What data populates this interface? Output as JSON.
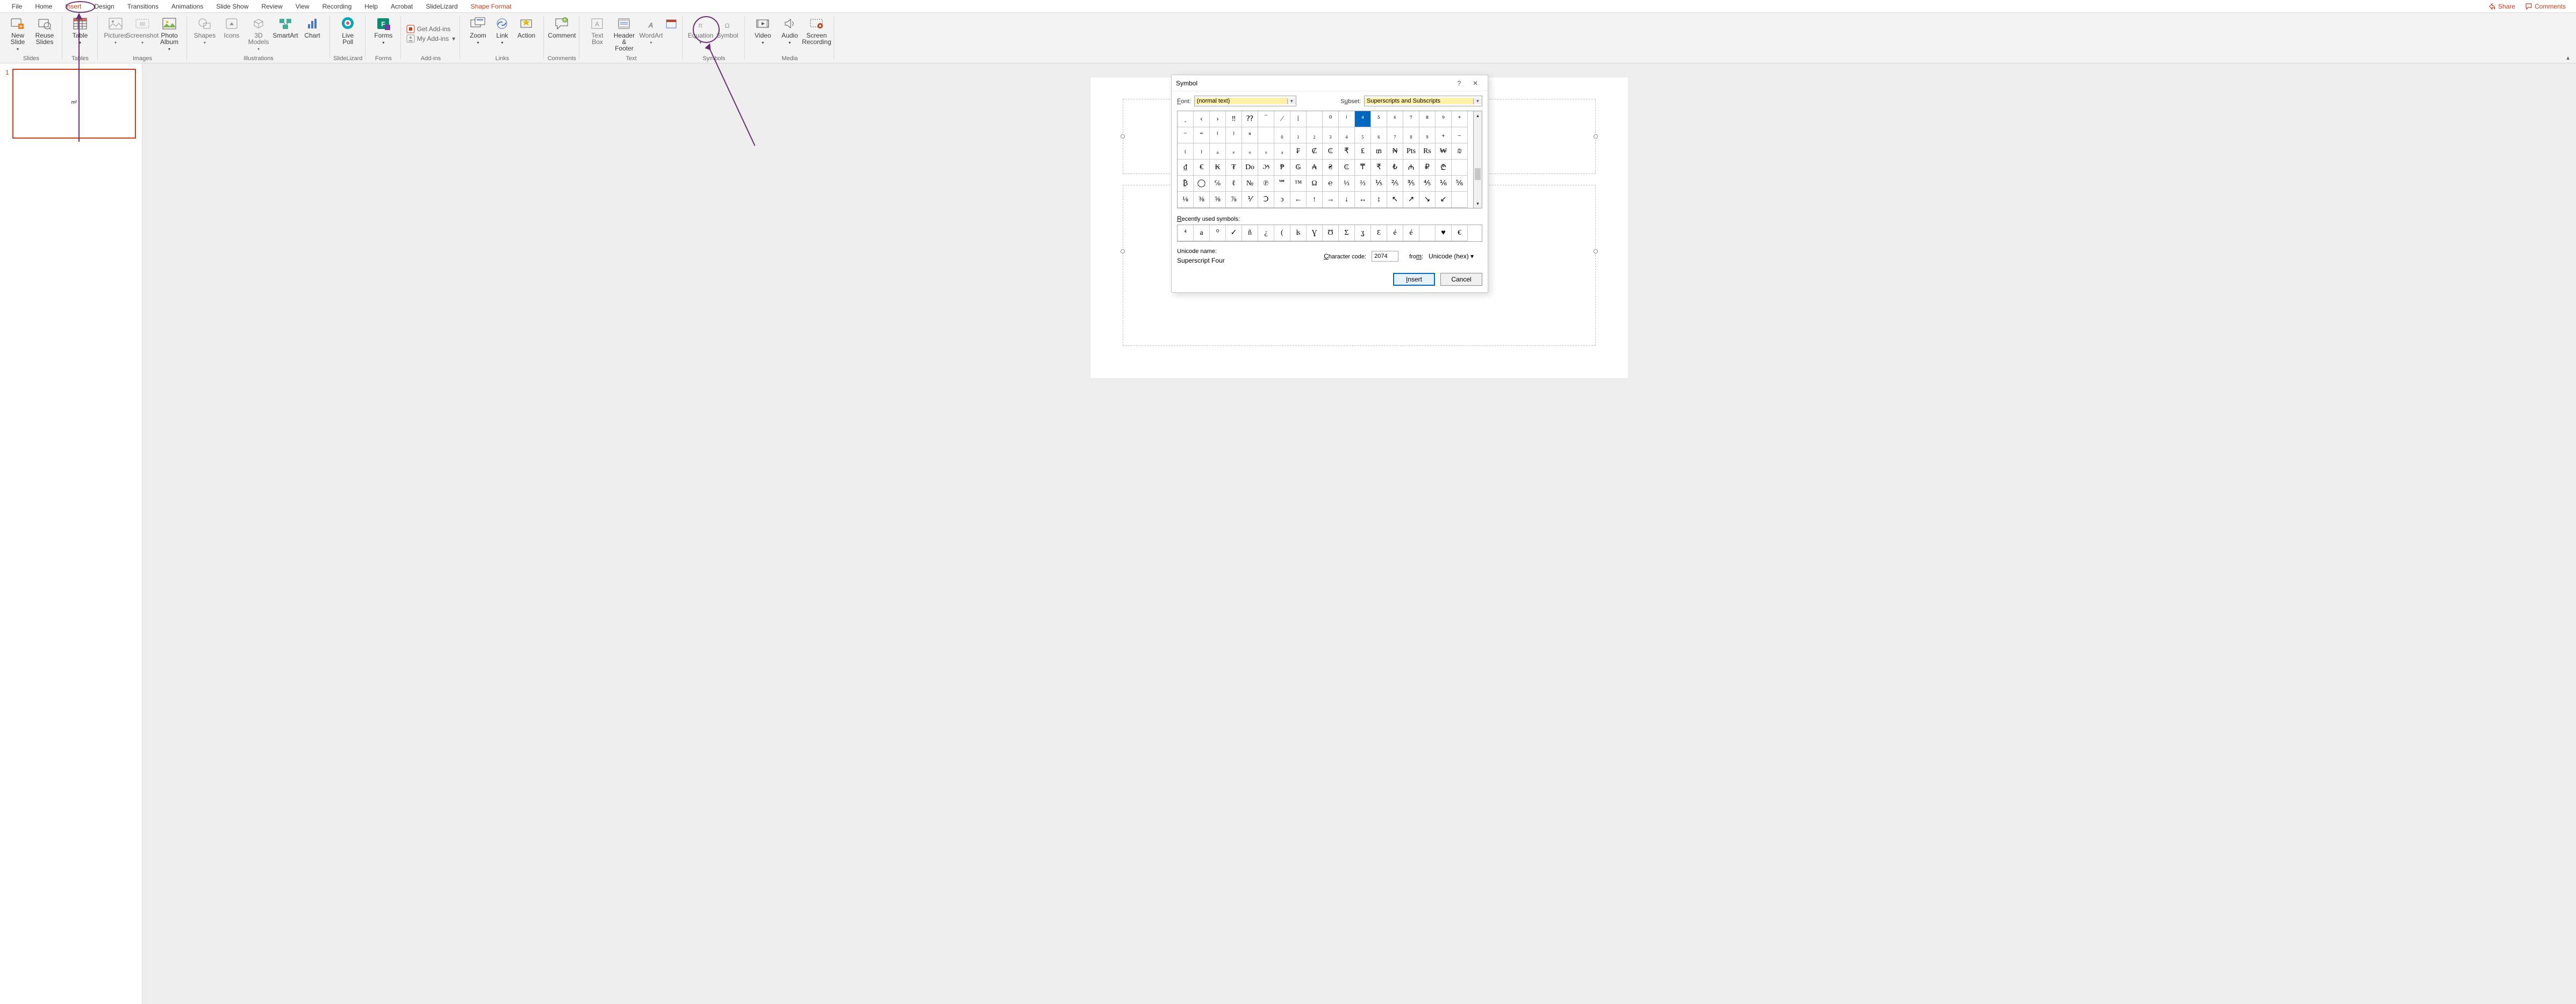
{
  "menubar": {
    "tabs": [
      "File",
      "Home",
      "Insert",
      "Design",
      "Transitions",
      "Animations",
      "Slide Show",
      "Review",
      "View",
      "Recording",
      "Help",
      "Acrobat",
      "SlideLizard",
      "Shape Format"
    ],
    "share": "Share",
    "comments": "Comments"
  },
  "ribbon": {
    "groups": {
      "slides": {
        "label": "Slides",
        "new_slide": "New\nSlide",
        "reuse": "Reuse\nSlides"
      },
      "tables": {
        "label": "Tables",
        "table": "Table"
      },
      "images": {
        "label": "Images",
        "pictures": "Pictures",
        "screenshot": "Screenshot",
        "photo_album": "Photo\nAlbum"
      },
      "illustrations": {
        "label": "Illustrations",
        "shapes": "Shapes",
        "icons": "Icons",
        "models": "3D\nModels",
        "smartart": "SmartArt",
        "chart": "Chart"
      },
      "slidelizard": {
        "label": "SlideLizard",
        "live_poll": "Live\nPoll"
      },
      "forms": {
        "label": "Forms",
        "forms": "Forms"
      },
      "addins": {
        "label": "Add-ins",
        "get": "Get Add-ins",
        "my": "My Add-ins"
      },
      "links": {
        "label": "Links",
        "zoom": "Zoom",
        "link": "Link",
        "action": "Action"
      },
      "comments": {
        "label": "Comments",
        "comment": "Comment"
      },
      "text": {
        "label": "Text",
        "textbox": "Text\nBox",
        "header": "Header\n& Footer",
        "wordart": "WordArt",
        "date": ""
      },
      "symbols": {
        "label": "Symbols",
        "equation": "Equation",
        "symbol": "Symbol"
      },
      "media": {
        "label": "Media",
        "video": "Video",
        "audio": "Audio",
        "screen": "Screen\nRecording"
      }
    }
  },
  "thumb": {
    "num": "1",
    "content": "m²"
  },
  "dialog": {
    "title": "Symbol",
    "font_label": "Font:",
    "font_value": "(normal text)",
    "subset_label": "Subset:",
    "subset_value": "Superscripts and Subscripts",
    "grid": [
      [
        "˰",
        "‹",
        "›",
        "‼",
        "⁇",
        "‾",
        "⁄",
        "⁞",
        "",
        "⁰",
        "ⁱ",
        "⁴",
        "⁵",
        "⁶",
        "⁷",
        "⁸",
        "⁹",
        "⁺"
      ],
      [
        "⁻",
        "⁼",
        "⁽",
        "⁾",
        "ⁿ",
        "",
        "₀",
        "₁",
        "₂",
        "₃",
        "₄",
        "₅",
        "₆",
        "₇",
        "₈",
        "₉",
        "₊",
        "₋"
      ],
      [
        "₍",
        "₎",
        "ₐ",
        "ₑ",
        "ₒ",
        "ₓ",
        "ₔ",
        "₣",
        "₡",
        "₵",
        "₹",
        "₤",
        "₥",
        "₦",
        "Pts",
        "Rs",
        "₩",
        "₪"
      ],
      [
        "₫",
        "€",
        "₭",
        "₮",
        "Do",
        "ઝ",
        "₱",
        "₲",
        "₳",
        "₴",
        "₵",
        "₸",
        "₹",
        "₺",
        "₼",
        "₽",
        "₾",
        ""
      ],
      [
        "₿",
        "◯",
        "℅",
        "ℓ",
        "№",
        "℗",
        "℠",
        "™",
        "Ω",
        "℮",
        "⅓",
        "⅔",
        "⅕",
        "⅖",
        "⅗",
        "⅘",
        "⅙",
        "⅚"
      ],
      [
        "⅛",
        "⅜",
        "⅝",
        "⅞",
        "⅟",
        "Ↄ",
        "ↄ",
        "←",
        "↑",
        "→",
        "↓",
        "↔",
        "↕",
        "↖",
        "↗",
        "↘",
        "↙",
        ""
      ]
    ],
    "selected_row": 0,
    "selected_col": 11,
    "recent_label": "Recently used symbols:",
    "recent": [
      "⁴",
      "a",
      "⁰",
      "✓",
      "ñ",
      "¿",
      "(",
      "ʪ",
      "Ɣ",
      "Ʊ",
      "Ʃ",
      "ʓ",
      "Ɛ",
      "é",
      "é",
      "",
      "♥",
      "€"
    ],
    "unicode_name_label": "Unicode name:",
    "unicode_name": "Superscript Four",
    "char_code_label": "Character code:",
    "char_code": "2074",
    "from_label": "from:",
    "from_value": "Unicode (hex)",
    "insert": "Insert",
    "cancel": "Cancel"
  }
}
